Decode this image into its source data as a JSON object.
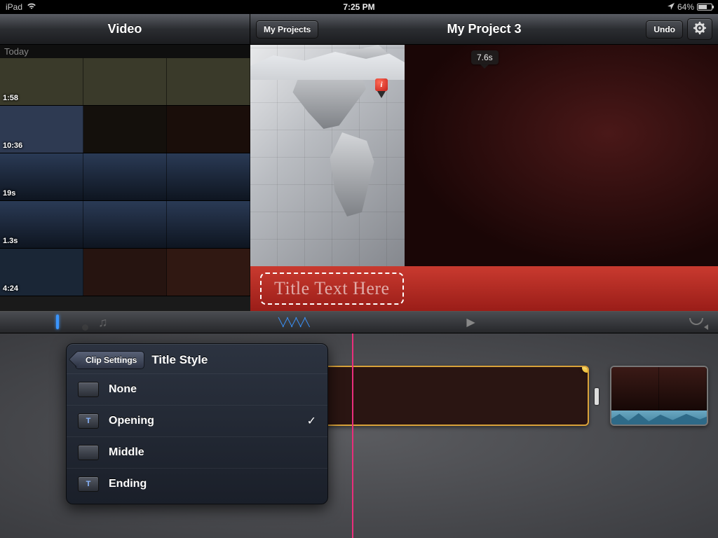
{
  "status": {
    "device": "iPad",
    "time": "7:25 PM",
    "battery_pct": "64%",
    "location_on": true
  },
  "header": {
    "library_title": "Video",
    "my_projects_label": "My Projects",
    "project_title": "My Project 3",
    "undo_label": "Undo"
  },
  "library": {
    "section": "Today",
    "clips": [
      {
        "duration": "1:58",
        "kind": "people"
      },
      {
        "duration": "10:36",
        "kind": "dark"
      },
      {
        "duration": "19s",
        "kind": "control"
      },
      {
        "duration": "1.3s",
        "kind": "control"
      },
      {
        "duration": "4:24",
        "kind": "dark"
      }
    ]
  },
  "preview": {
    "playhead_duration": "7.6s",
    "title_placeholder": "Title Text Here"
  },
  "toolbar": {
    "tabs": [
      "video",
      "photo",
      "audio"
    ],
    "active_tab": "video"
  },
  "popover": {
    "back_label": "Clip Settings",
    "title": "Title Style",
    "items": [
      {
        "label": "None",
        "thumb": "",
        "selected": false
      },
      {
        "label": "Opening",
        "thumb": "T",
        "selected": true
      },
      {
        "label": "Middle",
        "thumb": "",
        "selected": false
      },
      {
        "label": "Ending",
        "thumb": "T",
        "selected": false
      }
    ]
  }
}
